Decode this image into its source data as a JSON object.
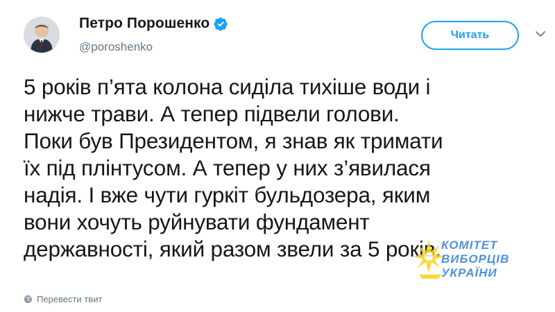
{
  "author": {
    "display_name": "Петро Порошенко",
    "handle": "@poroshenko",
    "verified_icon": "verified-badge-icon"
  },
  "actions": {
    "follow_label": "Читать",
    "more_icon": "chevron-down-icon"
  },
  "tweet": {
    "text": "5 років п’ята колона сиділа тихіше води і\nнижче трави. А тепер підвели голови.\nПоки був Президентом, я знав як тримати\nїх під плінтусом. А тепер у них з’явилася\nнадія. І вже чути гуркіт бульдозера, яким\nвони хочуть руйнувати фундамент\nдержавності, який разом звели за 5 років."
  },
  "footer": {
    "translate_label": "Перевести твит",
    "translate_icon": "globe-icon"
  },
  "watermark": {
    "line1": "КОМІТЕТ",
    "line2": "ВИБОРЦІВ",
    "line3": "УКРАЇНИ"
  },
  "colors": {
    "accent": "#1da1f2",
    "text": "#14171a",
    "muted": "#657786",
    "watermark_blue": "#2c7fd1",
    "watermark_yellow": "#f6d31c"
  }
}
